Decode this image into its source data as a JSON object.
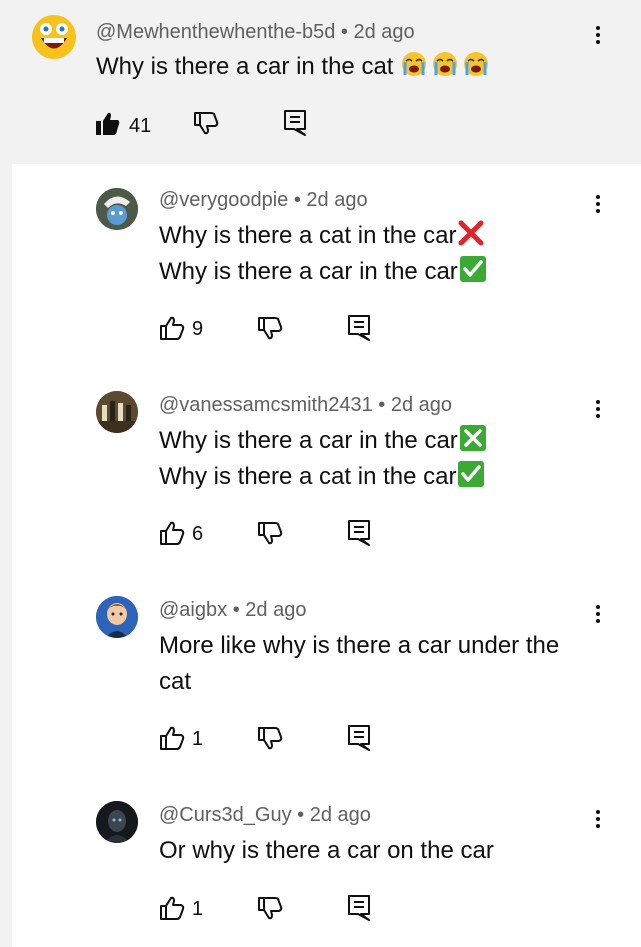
{
  "main_comment": {
    "handle": "@Mewhenthewhenthe-b5d",
    "age": "2d ago",
    "text": "Why is there a car in the cat",
    "emoji": [
      "loudly-crying-face",
      "loudly-crying-face",
      "loudly-crying-face"
    ],
    "likes": "41",
    "liked": true
  },
  "replies": [
    {
      "handle": "@verygoodpie",
      "age": "2d ago",
      "lines": [
        "Why is there a cat in the car",
        "Why is there a car in the car"
      ],
      "marks": [
        "cross-mark-red",
        "check-mark-green"
      ],
      "likes": "9"
    },
    {
      "handle": "@vanessamcsmith2431",
      "age": "2d ago",
      "lines": [
        "Why is there a car in the car",
        "Why is there a cat in the car"
      ],
      "marks": [
        "cross-mark-green",
        "check-mark-green"
      ],
      "likes": "6"
    },
    {
      "handle": "@aigbx",
      "age": "2d ago",
      "lines": [
        "More like why is there a car under the",
        "cat"
      ],
      "likes": "1"
    },
    {
      "handle": "@Curs3d_Guy",
      "age": "2d ago",
      "lines": [
        "Or why is there a car on the car"
      ],
      "likes": "1"
    }
  ],
  "separator": "•",
  "colors": {
    "highlight_bg": "#f2f2f2",
    "meta_text": "#606060",
    "text": "#0f0f0f",
    "check_green": "#3aaa35",
    "cross_red": "#e0242a"
  }
}
